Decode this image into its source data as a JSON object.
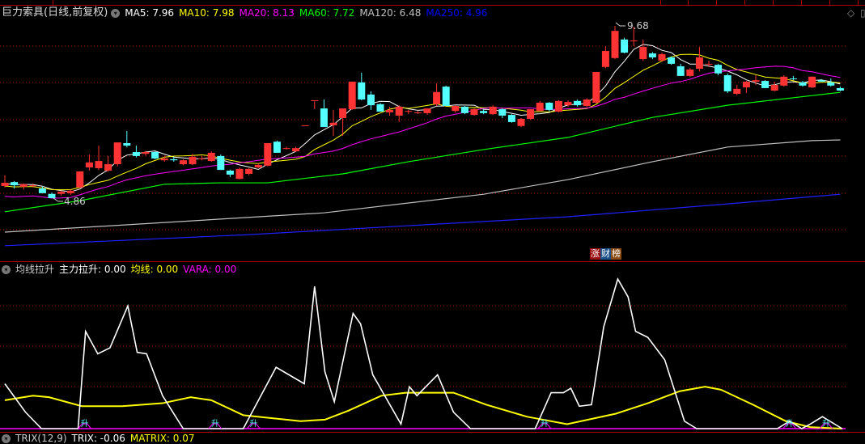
{
  "header": {
    "title": "巨力索具(日线,前复权)",
    "ma": [
      {
        "label": "MA5: 7.96",
        "color": "#ffffff"
      },
      {
        "label": "MA10: 7.98",
        "color": "#ffff00"
      },
      {
        "label": "MA20: 8.13",
        "color": "#ff00ff"
      },
      {
        "label": "MA60: 7.72",
        "color": "#00ff00"
      },
      {
        "label": "MA120: 6.48",
        "color": "#c0c0c0"
      },
      {
        "label": "MA250: 4.96",
        "color": "#0000ff"
      }
    ]
  },
  "badge": {
    "parts": [
      "涨",
      "财",
      "榜"
    ],
    "colors": [
      "#9b0f0f",
      "#1b4f8a",
      "#8a4a10"
    ]
  },
  "indicator": {
    "name": "均线拉升",
    "items": [
      {
        "label": "主力拉升: 0.00",
        "color": "#ffffff"
      },
      {
        "label": "均线: 0.00",
        "color": "#ffff00"
      },
      {
        "label": "VARA: 0.00",
        "color": "#ff00ff"
      }
    ]
  },
  "trix": {
    "name": "TRIX(12,9)",
    "items": [
      {
        "label": "TRIX: -0.06",
        "color": "#ffffff"
      },
      {
        "label": "MATRIX: 0.07",
        "color": "#ffff00"
      }
    ]
  },
  "colors": {
    "up": "#ff3333",
    "down": "#54ffff",
    "grid": "#a00000"
  },
  "chart_data": {
    "type": "candlestick",
    "price_range": [
      4.2,
      10.2
    ],
    "high_label": "9.68",
    "low_label": "4.86",
    "high_index": 65,
    "low_index": 5,
    "candles_ohlc": [
      [
        5.2,
        5.5,
        5.16,
        5.29
      ],
      [
        5.31,
        5.34,
        5.13,
        5.22
      ],
      [
        5.18,
        5.27,
        5.1,
        5.25
      ],
      [
        5.22,
        5.27,
        5.16,
        5.22
      ],
      [
        5.13,
        5.18,
        5.1,
        5.0
      ],
      [
        4.98,
        5.02,
        4.86,
        4.86
      ],
      [
        4.98,
        5.07,
        4.93,
        5.04
      ],
      [
        5.0,
        5.1,
        4.95,
        5.07
      ],
      [
        5.16,
        5.61,
        5.14,
        5.61
      ],
      [
        5.72,
        6.08,
        5.63,
        5.86
      ],
      [
        5.7,
        6.33,
        5.65,
        5.9
      ],
      [
        5.63,
        6.04,
        5.6,
        5.81
      ],
      [
        5.81,
        6.42,
        5.75,
        6.42
      ],
      [
        6.4,
        6.74,
        6.28,
        6.33
      ],
      [
        6.15,
        6.33,
        6.0,
        6.04
      ],
      [
        6.1,
        6.18,
        6.05,
        6.15
      ],
      [
        6.15,
        6.17,
        5.95,
        5.97
      ],
      [
        5.92,
        6.05,
        5.88,
        5.97
      ],
      [
        5.95,
        6.02,
        5.88,
        5.92
      ],
      [
        5.81,
        5.95,
        5.78,
        5.92
      ],
      [
        5.81,
        6.1,
        5.78,
        6.02
      ],
      [
        5.97,
        6.04,
        5.92,
        5.97
      ],
      [
        5.9,
        6.17,
        5.88,
        6.13
      ],
      [
        6.04,
        6.08,
        5.65,
        5.65
      ],
      [
        5.63,
        5.66,
        5.45,
        5.52
      ],
      [
        5.4,
        5.72,
        5.38,
        5.68
      ],
      [
        5.54,
        5.7,
        5.5,
        5.68
      ],
      [
        5.72,
        5.84,
        5.7,
        5.79
      ],
      [
        5.77,
        6.4,
        5.75,
        6.4
      ],
      [
        6.44,
        6.47,
        6.13,
        6.13
      ],
      [
        6.26,
        6.3,
        6.22,
        6.26
      ],
      [
        6.17,
        6.3,
        6.15,
        6.26
      ],
      [
        6.9,
        6.9,
        6.9,
        6.9
      ],
      [
        7.6,
        7.6,
        7.35,
        7.6
      ],
      [
        7.37,
        7.62,
        6.85,
        6.85
      ],
      [
        6.9,
        7.33,
        6.6,
        6.97
      ],
      [
        7.1,
        7.37,
        6.6,
        7.37
      ],
      [
        7.35,
        8.12,
        7.33,
        8.12
      ],
      [
        8.1,
        8.37,
        7.6,
        7.62
      ],
      [
        7.76,
        7.85,
        7.33,
        7.46
      ],
      [
        7.49,
        7.52,
        7.3,
        7.28
      ],
      [
        7.26,
        7.42,
        7.17,
        7.33
      ],
      [
        7.17,
        7.46,
        6.99,
        7.42
      ],
      [
        7.3,
        7.33,
        7.21,
        7.3
      ],
      [
        7.26,
        7.3,
        7.21,
        7.26
      ],
      [
        7.24,
        7.37,
        7.19,
        7.37
      ],
      [
        7.49,
        8.07,
        7.44,
        7.83
      ],
      [
        7.98,
        8.01,
        7.44,
        7.44
      ],
      [
        7.3,
        7.46,
        7.26,
        7.44
      ],
      [
        7.42,
        7.44,
        7.21,
        7.24
      ],
      [
        7.19,
        7.37,
        7.17,
        7.35
      ],
      [
        7.3,
        7.35,
        7.21,
        7.24
      ],
      [
        7.21,
        7.46,
        7.19,
        7.42
      ],
      [
        7.35,
        7.37,
        7.1,
        7.17
      ],
      [
        7.19,
        7.21,
        6.97,
        6.99
      ],
      [
        6.88,
        7.1,
        6.85,
        7.08
      ],
      [
        7.08,
        7.35,
        7.05,
        7.35
      ],
      [
        7.3,
        7.58,
        7.28,
        7.53
      ],
      [
        7.53,
        7.55,
        7.28,
        7.33
      ],
      [
        7.28,
        7.6,
        7.26,
        7.58
      ],
      [
        7.46,
        7.6,
        7.42,
        7.55
      ],
      [
        7.58,
        7.62,
        7.42,
        7.46
      ],
      [
        7.44,
        7.66,
        7.4,
        7.62
      ],
      [
        7.53,
        8.39,
        7.5,
        8.39
      ],
      [
        8.53,
        9.11,
        8.5,
        8.98
      ],
      [
        8.78,
        9.68,
        8.75,
        9.54
      ],
      [
        9.3,
        9.35,
        8.91,
        8.93
      ],
      [
        9.27,
        9.66,
        9.11,
        9.27
      ],
      [
        8.75,
        9.3,
        8.7,
        9.09
      ],
      [
        8.91,
        8.95,
        8.75,
        8.8
      ],
      [
        8.71,
        8.93,
        8.68,
        8.89
      ],
      [
        8.8,
        8.82,
        8.59,
        8.62
      ],
      [
        8.55,
        8.62,
        8.28,
        8.28
      ],
      [
        8.28,
        8.5,
        8.25,
        8.46
      ],
      [
        8.48,
        9.09,
        8.4,
        8.8
      ],
      [
        8.62,
        8.71,
        8.53,
        8.62
      ],
      [
        8.59,
        8.62,
        8.3,
        8.35
      ],
      [
        8.3,
        8.35,
        7.8,
        7.85
      ],
      [
        7.78,
        8.03,
        7.74,
        7.92
      ],
      [
        7.96,
        8.14,
        7.8,
        8.12
      ],
      [
        8.12,
        8.3,
        8.03,
        8.16
      ],
      [
        8.14,
        8.16,
        7.94,
        7.94
      ],
      [
        7.87,
        8.12,
        7.85,
        8.03
      ],
      [
        8.01,
        8.3,
        7.98,
        8.26
      ],
      [
        8.21,
        8.28,
        8.16,
        8.19
      ],
      [
        8.1,
        8.14,
        7.98,
        8.01
      ],
      [
        7.96,
        8.26,
        7.94,
        8.26
      ],
      [
        8.16,
        8.19,
        8.12,
        8.12
      ],
      [
        8.1,
        8.21,
        7.98,
        8.01
      ],
      [
        7.94,
        7.98,
        7.85,
        7.87
      ]
    ],
    "ma_long": [
      {
        "name": "MA60",
        "color": "#00ff00",
        "points": [
          [
            0,
            4.48
          ],
          [
            8,
            4.79
          ],
          [
            17,
            5.25
          ],
          [
            23,
            5.29
          ],
          [
            28,
            5.29
          ],
          [
            36,
            5.54
          ],
          [
            43,
            5.88
          ],
          [
            51,
            6.22
          ],
          [
            60,
            6.56
          ],
          [
            69,
            7.12
          ],
          [
            77,
            7.46
          ],
          [
            86,
            7.73
          ],
          [
            89,
            7.82
          ]
        ]
      },
      {
        "name": "MA120",
        "color": "#c0c0c0",
        "points": [
          [
            0,
            3.91
          ],
          [
            17,
            4.18
          ],
          [
            34,
            4.45
          ],
          [
            51,
            4.97
          ],
          [
            60,
            5.38
          ],
          [
            69,
            5.88
          ],
          [
            77,
            6.29
          ],
          [
            86,
            6.47
          ],
          [
            89,
            6.49
          ]
        ]
      },
      {
        "name": "MA250",
        "color": "#2020ff",
        "points": [
          [
            0,
            3.53
          ],
          [
            26,
            3.84
          ],
          [
            43,
            4.09
          ],
          [
            60,
            4.34
          ],
          [
            77,
            4.7
          ],
          [
            89,
            4.97
          ]
        ]
      }
    ],
    "indicator_range": [
      0,
      100
    ],
    "indicator_series": [
      {
        "name": "主力拉升",
        "color": "#ffffff",
        "points": [
          [
            0,
            30
          ],
          [
            2.2,
            11
          ],
          [
            3.9,
            0
          ],
          [
            7.8,
            0
          ],
          [
            8.6,
            65
          ],
          [
            9.9,
            50
          ],
          [
            11.2,
            54
          ],
          [
            13.1,
            82
          ],
          [
            14.1,
            51
          ],
          [
            15.1,
            50
          ],
          [
            16.8,
            22
          ],
          [
            19,
            0
          ],
          [
            21.1,
            0
          ],
          [
            25.4,
            0
          ],
          [
            28.9,
            41
          ],
          [
            31.9,
            30
          ],
          [
            33,
            95
          ],
          [
            34.1,
            38
          ],
          [
            35.1,
            18
          ],
          [
            37.1,
            77
          ],
          [
            37.9,
            70
          ],
          [
            39.2,
            36
          ],
          [
            42.2,
            3
          ],
          [
            43.1,
            28
          ],
          [
            43.9,
            22
          ],
          [
            46.1,
            36
          ],
          [
            47.8,
            11
          ],
          [
            49.6,
            0
          ],
          [
            56.5,
            0
          ],
          [
            58.2,
            24
          ],
          [
            59.5,
            24
          ],
          [
            60.3,
            27
          ],
          [
            61.2,
            15
          ],
          [
            62.5,
            16
          ],
          [
            63.8,
            68
          ],
          [
            65.3,
            100
          ],
          [
            66.4,
            88
          ],
          [
            67.2,
            65
          ],
          [
            68.5,
            61
          ],
          [
            70.3,
            46
          ],
          [
            72.4,
            5
          ],
          [
            73.7,
            0
          ],
          [
            82.3,
            0
          ],
          [
            83.6,
            5
          ],
          [
            84.9,
            0
          ],
          [
            85.8,
            3
          ],
          [
            87.1,
            8
          ],
          [
            89.2,
            0
          ]
        ]
      },
      {
        "name": "均线",
        "color": "#ffff00",
        "points": [
          [
            0,
            19
          ],
          [
            3,
            22
          ],
          [
            4.7,
            21
          ],
          [
            8.2,
            15
          ],
          [
            12.5,
            15
          ],
          [
            16.8,
            17
          ],
          [
            19.8,
            21
          ],
          [
            22,
            19
          ],
          [
            25.4,
            9
          ],
          [
            31.5,
            5
          ],
          [
            34.1,
            6
          ],
          [
            36.6,
            12
          ],
          [
            40.1,
            22
          ],
          [
            42.7,
            24
          ],
          [
            47.8,
            24
          ],
          [
            51.3,
            16
          ],
          [
            55.6,
            8
          ],
          [
            59.9,
            3
          ],
          [
            65.1,
            10
          ],
          [
            68.5,
            17
          ],
          [
            71.9,
            25
          ],
          [
            74.6,
            28
          ],
          [
            76.3,
            26
          ],
          [
            79.7,
            16
          ],
          [
            83.2,
            5
          ],
          [
            85.8,
            1
          ],
          [
            89.2,
            0
          ]
        ]
      }
    ],
    "signals": {
      "label": "升",
      "indices": [
        8.5,
        22.4,
        26.5,
        57.5,
        83.6,
        87.5
      ]
    }
  }
}
